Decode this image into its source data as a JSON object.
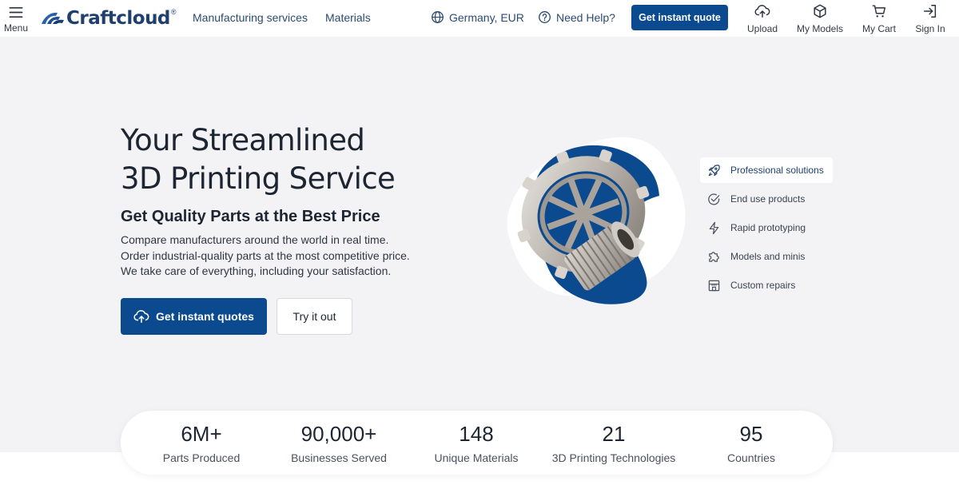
{
  "header": {
    "menu_label": "Menu",
    "brand": "Craftcloud",
    "brand_mark": "®",
    "nav": [
      "Manufacturing services",
      "Materials"
    ],
    "region": "Germany, EUR",
    "help": "Need Help?",
    "cta": "Get instant quote",
    "icons": [
      {
        "label": "Upload",
        "icon": "upload-cloud-icon"
      },
      {
        "label": "My Models",
        "icon": "cube-icon"
      },
      {
        "label": "My Cart",
        "icon": "cart-icon"
      },
      {
        "label": "Sign In",
        "icon": "sign-in-icon"
      }
    ]
  },
  "hero": {
    "title_line1": "Your Streamlined",
    "title_line2": "3D Printing Service",
    "subtitle": "Get Quality Parts at the Best Price",
    "desc": [
      "Compare manufacturers around the world in real time.",
      "Order industrial-quality parts at the most competitive price.",
      "We take care of everything, including your satisfaction."
    ],
    "primary_button": "Get instant quotes",
    "secondary_button": "Try it out"
  },
  "solutions": [
    {
      "label": "Professional solutions",
      "icon": "rocket-icon",
      "active": true
    },
    {
      "label": "End use products",
      "icon": "check-circle-icon",
      "active": false
    },
    {
      "label": "Rapid prototyping",
      "icon": "lightning-icon",
      "active": false
    },
    {
      "label": "Models and minis",
      "icon": "puzzle-icon",
      "active": false
    },
    {
      "label": "Custom repairs",
      "icon": "storefront-icon",
      "active": false
    }
  ],
  "stats": [
    {
      "value": "6M+",
      "label": "Parts Produced"
    },
    {
      "value": "90,000+",
      "label": "Businesses Served"
    },
    {
      "value": "148",
      "label": "Unique Materials"
    },
    {
      "value": "21",
      "label": "3D Printing Technologies"
    },
    {
      "value": "95",
      "label": "Countries"
    }
  ],
  "colors": {
    "primary": "#0b4a8f",
    "brand_text": "#1f3f6e",
    "link": "#2a4a72",
    "background": "#f3f3f5"
  }
}
